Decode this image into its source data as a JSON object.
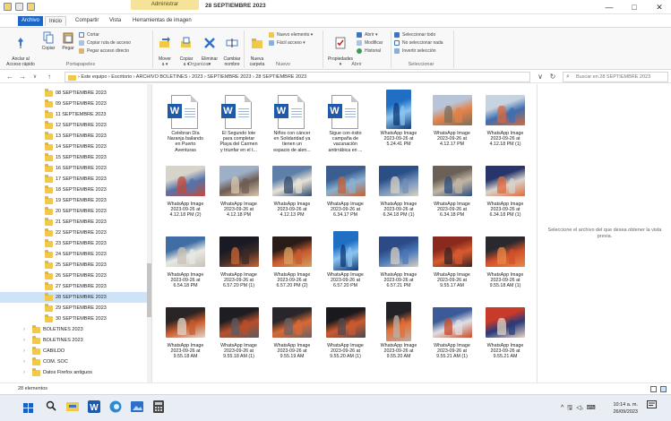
{
  "window": {
    "title": "28 SEPTIEMBRE 2023",
    "context_tab": "Administrar",
    "controls": {
      "minimize": "—",
      "maximize": "□",
      "close": "✕"
    }
  },
  "ribbon": {
    "tabs": [
      "Archivo",
      "Inicio",
      "Compartir",
      "Vista",
      "Herramientas de imagen"
    ],
    "portapapeles": {
      "group_label": "Portapapeles",
      "anclar": "Anclar al\nAcceso rápido",
      "copiar": "Copiar",
      "pegar": "Pegar",
      "cortar": "Cortar",
      "copiar_ruta": "Copiar ruta de acceso",
      "pegar_acceso": "Pegar acceso directo"
    },
    "organizar": {
      "group_label": "Organizar",
      "mover": "Mover\na ▾",
      "copiar": "Copiar\na ▾",
      "eliminar": "Eliminar\n▾",
      "cambiar": "Cambiar\nnombre"
    },
    "nuevo": {
      "group_label": "Nuevo",
      "nueva_carpeta": "Nueva\ncarpeta",
      "nuevo_elemento": "Nuevo elemento ▾",
      "facil_acceso": "Fácil acceso ▾"
    },
    "abrir": {
      "group_label": "Abrir",
      "propiedades": "Propiedades\n▾",
      "abrir": "Abrir ▾",
      "modificar": "Modificar",
      "historial": "Historial"
    },
    "seleccionar": {
      "group_label": "Seleccionar",
      "todo": "Seleccionar todo",
      "ninguno": "No seleccionar nada",
      "invertir": "Invertir selección"
    }
  },
  "addressbar": {
    "path": "›  Este equipo  ›  Escritorio  ›  ARCHIVO BOLETINES  ›  2023  ›  SEPTIEMBRE 2023  ›  28 SEPTIEMBRE 2023",
    "search_placeholder": "Buscar en 28 SEPTIEMBRE 2023"
  },
  "navigation": {
    "items": [
      "08 SEPTIEMBRE 2023",
      "09 SEPTIEMBRE 2023",
      "11 SEPTIEMBRE 2023",
      "12 SEPTIEMBRE 2023",
      "13 SEPTIEMBRE 2023",
      "14 SEPTIEMBRE 2023",
      "15 SEPTIEMBRE 2023",
      "16 SEPTIEMBRE 2023",
      "17 SEPTIEMBRE 2023",
      "18 SEPTIEMBRE 2023",
      "19 SEPTIEMBRE 2023",
      "20 SEPTIEMBRE 2023",
      "21 SEPTIEMBRE 2023",
      "22 SEPTIEMBRE 2023",
      "23 SEPTIEMBRE 2023",
      "24 SEPTIEMBRE 2023",
      "25 SEPTIEMBRE 2023",
      "26 SEPTIEMBRE 2023",
      "27 SEPTIEMBRE 2023",
      "28 SEPTIEMBRE 2023",
      "29 SEPTIEMBRE 2023",
      "30 SEPTIEMBRE 2023"
    ],
    "top_items": [
      "BOLETINES 2023",
      "BOLETINES 2023",
      "CABILDO",
      "COM. SOC",
      "Datos Firefox antiguos"
    ]
  },
  "files": [
    {
      "kind": "word",
      "label": "Celebran Día\nNaranja bailando\nen Puerto\nAventuras"
    },
    {
      "kind": "word",
      "label": "El Segundo lote\npara completar\nPlaya del Carmen\ny triunfar en el t..."
    },
    {
      "kind": "word",
      "label": "Niños con cáncer\nen Solidaridad ya\ntienen un\nespacio de alen..."
    },
    {
      "kind": "word",
      "label": "Sigue con éxito\ncampaña de\nvacunación\nantirrábica en ..."
    },
    {
      "kind": "poster",
      "label": "WhatsApp Image\n2023-09-26 at\n5.24.41 PM"
    },
    {
      "kind": "photo",
      "label": "WhatsApp Image\n2023-09-26 at\n4.12.17 PM",
      "colors": [
        "#b8c4d8",
        "#e3824a",
        "#7a6f5c"
      ]
    },
    {
      "kind": "photo",
      "label": "WhatsApp Image\n2023-09-26 at\n4.12.18 PM (1)",
      "colors": [
        "#c8d3e0",
        "#3f6db0",
        "#d86a3a"
      ]
    },
    {
      "kind": "photo",
      "label": "WhatsApp Image\n2023-09-26 at\n4.12.18 PM (2)",
      "colors": [
        "#d7d4cc",
        "#5872a8",
        "#c44a3a"
      ]
    },
    {
      "kind": "photo",
      "label": "WhatsApp Image\n2023-09-26 at\n4.12.18 PM",
      "colors": [
        "#9eb0c8",
        "#6e5c52",
        "#d8c8b0"
      ]
    },
    {
      "kind": "photo",
      "label": "WhatsApp Image\n2023-09-26 at\n4.12.13 PM",
      "colors": [
        "#5e80a8",
        "#e8e2d6",
        "#2f4a6e"
      ]
    },
    {
      "kind": "photo",
      "label": "WhatsApp Image\n2023-09-26 at\n6.34.17 PM",
      "colors": [
        "#3a5e92",
        "#8ab0d0",
        "#c86030"
      ]
    },
    {
      "kind": "photo",
      "label": "WhatsApp Image\n2023-09-26 at\n6.34.18 PM (1)",
      "colors": [
        "#2a4e86",
        "#6f8fb8",
        "#d9d2c4"
      ]
    },
    {
      "kind": "photo",
      "label": "WhatsApp Image\n2023-09-26 at\n6.34.18 PM",
      "colors": [
        "#6a6058",
        "#c2b6a2",
        "#2e4c7e"
      ]
    },
    {
      "kind": "photo",
      "label": "WhatsApp Image\n2023-09-26 at\n6.34.18 PM (1)",
      "colors": [
        "#27356a",
        "#d8d4cc",
        "#e26a3c"
      ]
    },
    {
      "kind": "photo",
      "label": "WhatsApp Image\n2023-09-26 at\n6.54.18 PM",
      "colors": [
        "#3e6ea4",
        "#e8e8e4",
        "#c8c2b6"
      ]
    },
    {
      "kind": "photo",
      "label": "WhatsApp Image\n2023-09-26 at\n6.57.20 PM (1)",
      "colors": [
        "#1a1a24",
        "#3a2a26",
        "#c86838"
      ]
    },
    {
      "kind": "photo",
      "label": "WhatsApp Image\n2023-09-26 at\n6.57.20 PM (2)",
      "colors": [
        "#2a1c18",
        "#c45a2e",
        "#d8a060"
      ]
    },
    {
      "kind": "poster",
      "label": "WhatsApp Image\n2023-09-26 at\n6.57.20 PM"
    },
    {
      "kind": "photo",
      "label": "WhatsApp Image\n2023-09-26 at\n6.57.21 PM",
      "colors": [
        "#2c4a86",
        "#4a78b8",
        "#d8d0c2"
      ]
    },
    {
      "kind": "photo",
      "label": "WhatsApp Image\n2023-09-26 at\n9.55.17 AM",
      "colors": [
        "#8a2a1e",
        "#d85a30",
        "#3a2420"
      ]
    },
    {
      "kind": "photo",
      "label": "WhatsApp Image\n2023-09-26 at\n9.55.18 AM (1)",
      "colors": [
        "#2a2a2e",
        "#d0502a",
        "#e88a48"
      ]
    },
    {
      "kind": "photo",
      "label": "WhatsApp Image\n2023-09-26 at\n9.55.18 AM",
      "colors": [
        "#2a2424",
        "#c85a2c",
        "#e0d8ce"
      ]
    },
    {
      "kind": "photo",
      "label": "WhatsApp Image\n2023-09-26 at\n9.55.18 AM (1)",
      "colors": [
        "#1e1e22",
        "#b84e2a",
        "#5a5a60"
      ]
    },
    {
      "kind": "photo",
      "label": "WhatsApp Image\n2023-09-26 at\n9.55.19 AM",
      "colors": [
        "#28262a",
        "#d86a34",
        "#6a6064"
      ]
    },
    {
      "kind": "photo",
      "label": "WhatsApp Image\n2023-09-26 at\n9.55.20 AM (1)",
      "colors": [
        "#1a1a1e",
        "#cc5a30",
        "#4a4a50"
      ]
    },
    {
      "kind": "tall",
      "label": "WhatsApp Image\n2023-09-26 at\n9.55.20 AM",
      "colors": [
        "#222226",
        "#e26e36",
        "#b8b0a8"
      ]
    },
    {
      "kind": "photo",
      "label": "WhatsApp Image\n2023-09-26 at\n9.55.21 AM (1)",
      "colors": [
        "#3a5a98",
        "#e0e0e4",
        "#c84a2a"
      ]
    },
    {
      "kind": "photo",
      "label": "WhatsApp Image\n2023-09-26 at\n9.55.21 AM",
      "colors": [
        "#c83a2a",
        "#2a3a78",
        "#e8d6c4"
      ]
    }
  ],
  "preview": {
    "message": "Seleccione el archivo del que desea obtener la vista previa."
  },
  "status": {
    "count": "28 elementos"
  },
  "taskbar": {
    "time": "10:14 a. m.",
    "date": "26/09/2023",
    "tray": "^ 🖫 ◁ᵢ ⌨",
    "apps": [
      "search-icon",
      "file-explorer-icon",
      "word-icon",
      "edge-icon",
      "photos-icon",
      "calculator-icon"
    ]
  },
  "colors": {
    "accent": "#1e66c6",
    "selected": "#cde3f7",
    "folder": "#f2c84b",
    "word": "#1f5aa8"
  }
}
